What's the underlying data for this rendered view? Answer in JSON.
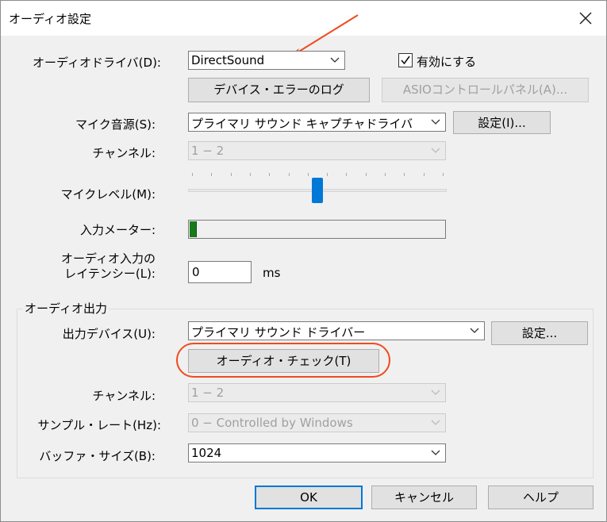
{
  "window": {
    "title": "オーディオ設定"
  },
  "driver": {
    "label": "オーディオドライバ(D):",
    "value": "DirectSound",
    "enable_label": "有効にする",
    "enabled": true,
    "error_log_button": "デバイス・エラーのログ",
    "asio_button": "ASIOコントロールパネル(A)..."
  },
  "mic_source": {
    "label": "マイク音源(S):",
    "value": "プライマリ サウンド キャプチャドライバ",
    "settings_button": "設定(I)..."
  },
  "input_channel": {
    "label": "チャンネル:",
    "value": "1 − 2"
  },
  "mic_level": {
    "label": "マイクレベル(M):",
    "level": 0.5,
    "ticks": 14
  },
  "input_meter": {
    "label": "入力メーター:",
    "level": 0.025
  },
  "latency": {
    "label_line1": "オーディオ入力の",
    "label_line2": "レイテンシー(L):",
    "value": "0",
    "unit": "ms"
  },
  "output": {
    "group_title": "オーディオ出力",
    "device_label": "出力デバイス(U):",
    "device_value": "プライマリ サウンド ドライバー",
    "settings_button": "設定...",
    "check_button": "オーディオ・チェック(T)",
    "channel_label": "チャンネル:",
    "channel_value": "1 − 2",
    "sample_rate_label": "サンプル・レート(Hz):",
    "sample_rate_value": "0 − Controlled by Windows",
    "buffer_label": "バッファ・サイズ(B):",
    "buffer_value": "1024"
  },
  "footer": {
    "ok": "OK",
    "cancel": "キャンセル",
    "help": "ヘルプ"
  },
  "colors": {
    "accent": "#0078d7",
    "annotation": "#f04a1e",
    "meter_fill": "#1a7a1a"
  }
}
